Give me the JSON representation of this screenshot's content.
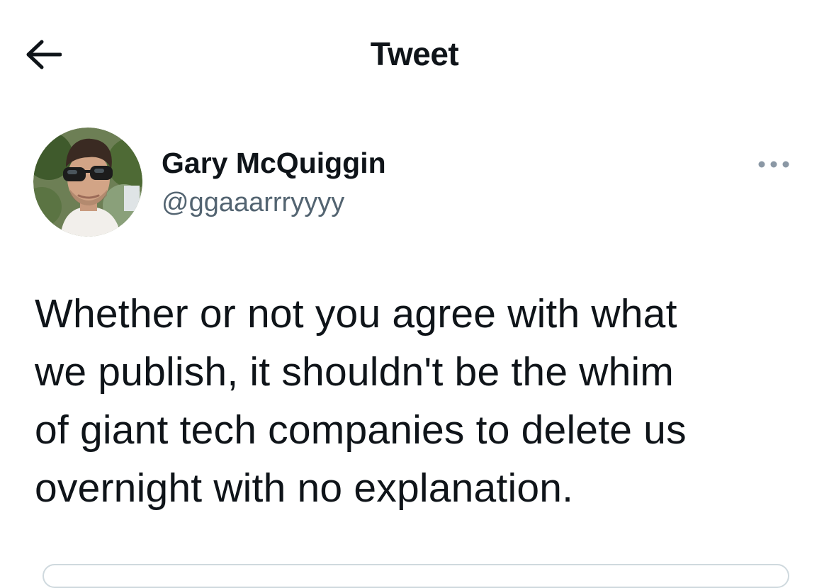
{
  "header": {
    "title": "Tweet",
    "back_icon": "arrow-left-icon"
  },
  "tweet": {
    "author": {
      "display_name": "Gary McQuiggin",
      "handle": "@ggaaarrryyyy",
      "avatar_icon": "profile-photo"
    },
    "more_icon": "more-horizontal-icon",
    "text": "Whether or not you agree with what\nwe publish, it shouldn't be the whim\nof giant tech companies to delete us\novernight with no explanation."
  },
  "colors": {
    "text_primary": "#0f1419",
    "text_secondary": "#536471",
    "border": "#cfd9de"
  }
}
